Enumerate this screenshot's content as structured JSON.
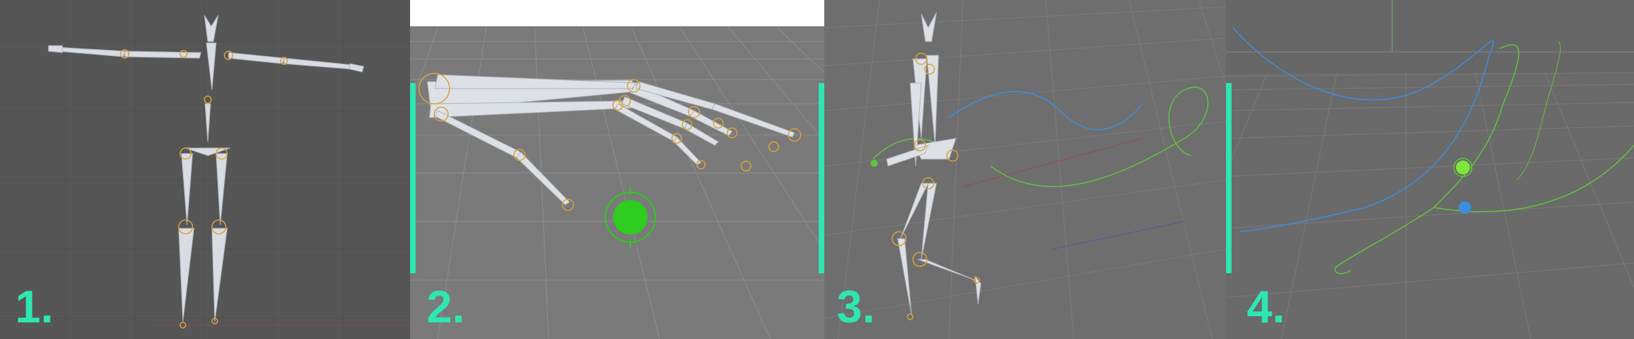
{
  "panels": [
    {
      "id": "1",
      "label": "1."
    },
    {
      "id": "2",
      "label": "2."
    },
    {
      "id": "3",
      "label": "3."
    },
    {
      "id": "4",
      "label": "4."
    }
  ],
  "colors": {
    "accent": "#2ee6b0",
    "bone": "#d9dde3",
    "joint": "#d9a23c",
    "target_green": "#2ecc1f",
    "spline_green": "#5ec43c",
    "spline_blue": "#3a8fe0",
    "grid": "#8a8a8a"
  },
  "icons": [
    "ik-goal-icon",
    "root-target-icon"
  ]
}
